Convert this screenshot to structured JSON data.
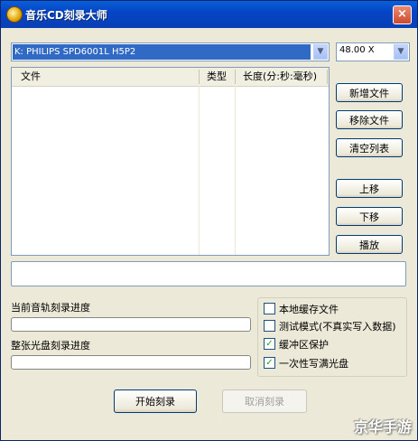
{
  "window": {
    "title": "音乐CD刻录大师",
    "close_glyph": "×"
  },
  "drive": {
    "value": "K: PHILIPS SPD6001L H5P2",
    "arrow": "▼"
  },
  "speed": {
    "value": "48.00 X",
    "arrow": "▼"
  },
  "filelist": {
    "columns": [
      "文件",
      "类型",
      "长度(分:秒:毫秒)"
    ],
    "rows": []
  },
  "buttons": {
    "add": "新增文件",
    "remove": "移除文件",
    "clear": "清空列表",
    "up": "上移",
    "down": "下移",
    "play": "播放",
    "start": "开始刻录",
    "cancel": "取消刻录"
  },
  "status": {
    "text": ""
  },
  "progress": {
    "track_label": "当前音轨刻录进度",
    "disc_label": "整张光盘刻录进度",
    "track_value": 0,
    "disc_value": 0
  },
  "options": [
    {
      "label": "本地缓存文件",
      "checked": false
    },
    {
      "label": "测试模式(不真实写入数据)",
      "checked": false
    },
    {
      "label": "缓冲区保护",
      "checked": true
    },
    {
      "label": "一次性写满光盘",
      "checked": true
    }
  ],
  "check_glyph": "✓",
  "watermark": "京华手游"
}
